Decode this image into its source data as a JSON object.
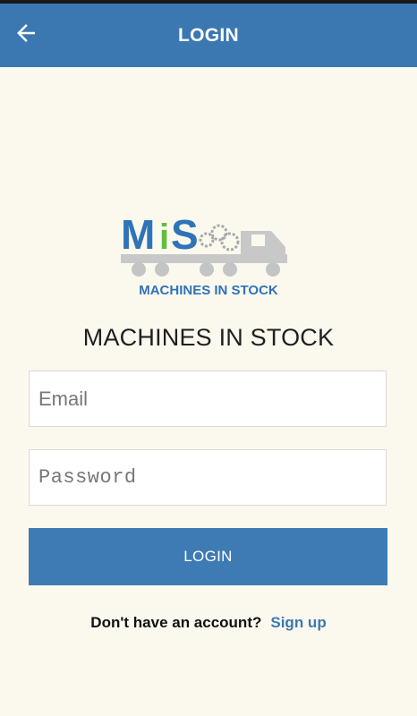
{
  "appbar": {
    "title": "LOGIN",
    "back_icon": "arrow-left-icon"
  },
  "logo": {
    "letters_m": "M",
    "letters_i": "i",
    "letters_s": "S",
    "tagline": "MACHINES IN STOCK"
  },
  "app_name": "MACHINES IN STOCK",
  "form": {
    "email_placeholder": "Email",
    "password_placeholder": "Password",
    "login_label": "LOGIN"
  },
  "signup": {
    "prompt": "Don't have an account?",
    "link": "Sign up"
  },
  "colors": {
    "appbar": "#3b78b2",
    "button": "#3e7bb5",
    "background": "#fbf9ee",
    "link": "#3b78b2"
  }
}
